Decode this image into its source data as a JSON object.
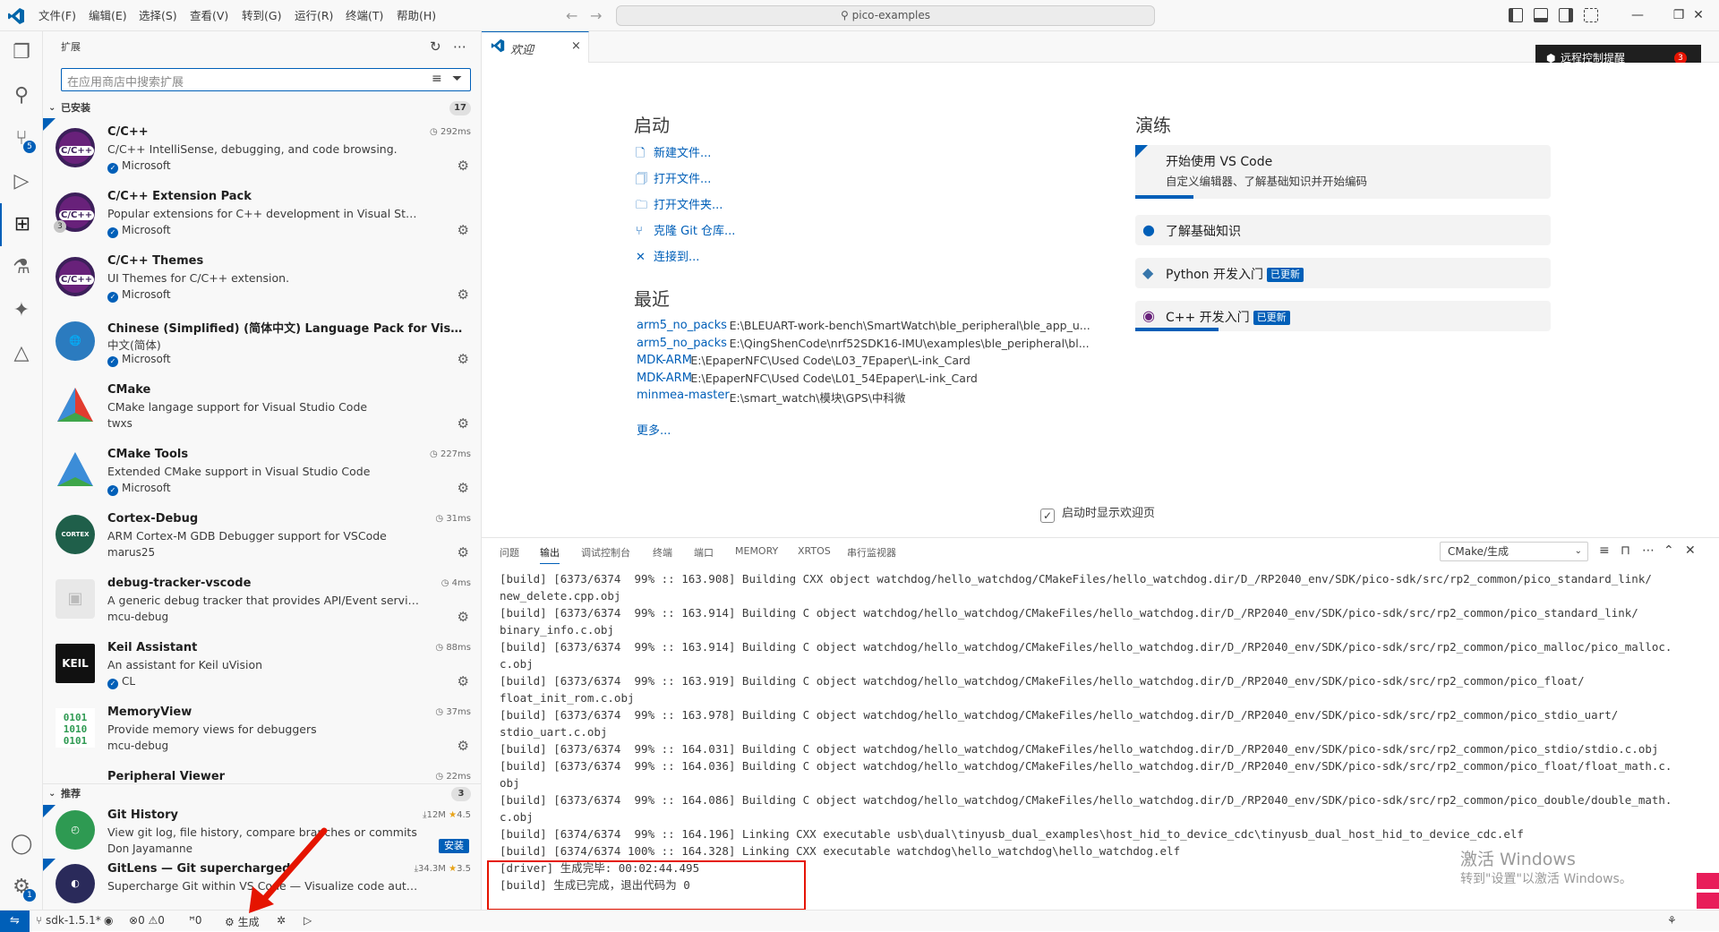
{
  "titlebar": {
    "menus": [
      "文件(F)",
      "编辑(E)",
      "选择(S)",
      "查看(V)",
      "转到(G)",
      "运行(R)",
      "终端(T)",
      "帮助(H)"
    ],
    "search": "pico-examples"
  },
  "activity": {
    "source_badge": "5",
    "settings_badge": "1"
  },
  "sidebar": {
    "title": "扩展",
    "search_placeholder": "在应用商店中搜索扩展",
    "installed_label": "已安装",
    "installed_count": "17",
    "recommended_label": "推荐",
    "recommended_count": "3",
    "installed": [
      {
        "name": "C/C++",
        "desc": "C/C++ IntelliSense, debugging, and code browsing.",
        "publisher": "Microsoft",
        "time": "292ms",
        "verified": true,
        "icon": "C/C++",
        "color": "#68217a",
        "badge": ""
      },
      {
        "name": "C/C++ Extension Pack",
        "desc": "Popular extensions for C++ development in Visual Studio Code.",
        "publisher": "Microsoft",
        "time": "",
        "verified": true,
        "icon": "C/C++",
        "color": "#68217a",
        "badge": "3"
      },
      {
        "name": "C/C++ Themes",
        "desc": "UI Themes for C/C++ extension.",
        "publisher": "Microsoft",
        "time": "",
        "verified": true,
        "icon": "C/C++",
        "color": "#68217a",
        "badge": ""
      },
      {
        "name": "Chinese (Simplified) (简体中文) Language Pack for Visual Studio Code",
        "desc": "中文(简体)",
        "publisher": "Microsoft",
        "time": "",
        "verified": true,
        "icon": "globe",
        "color": "#2b7bbf",
        "badge": ""
      },
      {
        "name": "CMake",
        "desc": "CMake langage support for Visual Studio Code",
        "publisher": "twxs",
        "time": "",
        "verified": false,
        "icon": "cmake",
        "color": "#e23c2f",
        "badge": ""
      },
      {
        "name": "CMake Tools",
        "desc": "Extended CMake support in Visual Studio Code",
        "publisher": "Microsoft",
        "time": "227ms",
        "verified": true,
        "icon": "cmake",
        "color": "#3c8dd8",
        "badge": ""
      },
      {
        "name": "Cortex-Debug",
        "desc": "ARM Cortex-M GDB Debugger support for VSCode",
        "publisher": "marus25",
        "time": "31ms",
        "verified": false,
        "icon": "CORTEX",
        "color": "#1f5f4a",
        "badge": ""
      },
      {
        "name": "debug-tracker-vscode",
        "desc": "A generic debug tracker that provides API/Event services for other extensions",
        "publisher": "mcu-debug",
        "time": "4ms",
        "verified": false,
        "icon": "box",
        "color": "#d8d8d8",
        "badge": ""
      },
      {
        "name": "Keil Assistant",
        "desc": "An assistant for Keil uVision",
        "publisher": "CL",
        "time": "88ms",
        "verified": true,
        "icon": "KEIL",
        "color": "#111111",
        "badge": ""
      },
      {
        "name": "MemoryView",
        "desc": "Provide memory views for debuggers",
        "publisher": "mcu-debug",
        "time": "37ms",
        "verified": false,
        "icon": "0101",
        "color": "#ffffff",
        "badge": ""
      },
      {
        "name": "Peripheral Viewer",
        "desc": "",
        "publisher": "",
        "time": "22ms",
        "verified": false,
        "icon": "",
        "color": "#ffffff",
        "badge": ""
      }
    ],
    "recommended": [
      {
        "name": "Git History",
        "desc": "View git log, file history, compare branches or commits",
        "publisher": "Don Jayamanne",
        "downloads": "12M",
        "rating": "4.5",
        "action": "安装",
        "icon": "git",
        "color": "#2e9a52"
      },
      {
        "name": "GitLens — Git supercharged",
        "desc": "Supercharge Git within VS Code — Visualize code authorship at a glance",
        "publisher": "",
        "downloads": "34.3M",
        "rating": "3.5",
        "action": "",
        "icon": "gitlens",
        "color": "#2a2a5a"
      }
    ]
  },
  "tab": {
    "label": "欢迎",
    "close": "×"
  },
  "remote_badge": {
    "label": "远程控制提醒",
    "count": "3"
  },
  "welcome": {
    "start_title": "启动",
    "start_links": [
      "新建文件...",
      "打开文件...",
      "打开文件夹...",
      "克隆 Git 仓库...",
      "连接到..."
    ],
    "recent_title": "最近",
    "recent": [
      {
        "name": "arm5_no_packs",
        "path": "E:\\BLEUART-work-bench\\SmartWatch\\ble_peripheral\\ble_app_u..."
      },
      {
        "name": "arm5_no_packs",
        "path": "E:\\QingShenCode\\nrf52SDK16-IMU\\examples\\ble_peripheral\\bl..."
      },
      {
        "name": "MDK-ARM",
        "path": "E:\\EpaperNFC\\Used Code\\L03_7Epaper\\L-ink_Card"
      },
      {
        "name": "MDK-ARM",
        "path": "E:\\EpaperNFC\\Used Code\\L01_54Epaper\\L-ink_Card"
      },
      {
        "name": "minmea-master",
        "path": "E:\\smart_watch\\模块\\GPS\\中科微"
      }
    ],
    "more": "更多...",
    "walk_title": "演练",
    "walks": [
      {
        "title": "开始使用 VS Code",
        "desc": "自定义编辑器、了解基础知识并开始编码",
        "badge": "",
        "progress": 0.14
      },
      {
        "title": "了解基础知识",
        "desc": "",
        "badge": "",
        "progress": 0
      },
      {
        "title": "Python 开发入门",
        "desc": "",
        "badge": "已更新",
        "progress": 0
      },
      {
        "title": "C++ 开发入门",
        "desc": "",
        "badge": "已更新",
        "progress": 0.2
      }
    ],
    "show_on_startup": "启动时显示欢迎页"
  },
  "panel": {
    "tabs": [
      "问题",
      "输出",
      "调试控制台",
      "终端",
      "端口",
      "MEMORY",
      "XRTOS",
      "串行监视器"
    ],
    "active_tab": 1,
    "channel": "CMake/生成",
    "lines": [
      "[build] [6373/6374  99% :: 163.908] Building CXX object watchdog/hello_watchdog/CMakeFiles/hello_watchdog.dir/D_/RP2040_env/SDK/pico-sdk/src/rp2_common/pico_standard_link/",
      "new_delete.cpp.obj",
      "[build] [6373/6374  99% :: 163.914] Building C object watchdog/hello_watchdog/CMakeFiles/hello_watchdog.dir/D_/RP2040_env/SDK/pico-sdk/src/rp2_common/pico_standard_link/",
      "binary_info.c.obj",
      "[build] [6373/6374  99% :: 163.914] Building C object watchdog/hello_watchdog/CMakeFiles/hello_watchdog.dir/D_/RP2040_env/SDK/pico-sdk/src/rp2_common/pico_malloc/pico_malloc.",
      "c.obj",
      "[build] [6373/6374  99% :: 163.919] Building C object watchdog/hello_watchdog/CMakeFiles/hello_watchdog.dir/D_/RP2040_env/SDK/pico-sdk/src/rp2_common/pico_float/",
      "float_init_rom.c.obj",
      "[build] [6373/6374  99% :: 163.978] Building C object watchdog/hello_watchdog/CMakeFiles/hello_watchdog.dir/D_/RP2040_env/SDK/pico-sdk/src/rp2_common/pico_stdio_uart/",
      "stdio_uart.c.obj",
      "[build] [6373/6374  99% :: 164.031] Building C object watchdog/hello_watchdog/CMakeFiles/hello_watchdog.dir/D_/RP2040_env/SDK/pico-sdk/src/rp2_common/pico_stdio/stdio.c.obj",
      "[build] [6373/6374  99% :: 164.036] Building C object watchdog/hello_watchdog/CMakeFiles/hello_watchdog.dir/D_/RP2040_env/SDK/pico-sdk/src/rp2_common/pico_float/float_math.c.",
      "obj",
      "[build] [6373/6374  99% :: 164.086] Building C object watchdog/hello_watchdog/CMakeFiles/hello_watchdog.dir/D_/RP2040_env/SDK/pico-sdk/src/rp2_common/pico_double/double_math.",
      "c.obj",
      "[build] [6374/6374  99% :: 164.196] Linking CXX executable usb\\dual\\tinyusb_dual_examples\\host_hid_to_device_cdc\\tinyusb_dual_host_hid_to_device_cdc.elf",
      "[build] [6374/6374 100% :: 164.328] Linking CXX executable watchdog\\hello_watchdog\\hello_watchdog.elf",
      "[driver] 生成完毕: 00:02:44.495",
      "[build] 生成已完成，退出代码为 0"
    ]
  },
  "watermark": {
    "line1": "激活 Windows",
    "line2": "转到\"设置\"以激活 Windows。"
  },
  "status": {
    "branch": "sdk-1.5.1*",
    "errors": "0",
    "warnings": "0",
    "ports": "0",
    "build": "生成"
  }
}
